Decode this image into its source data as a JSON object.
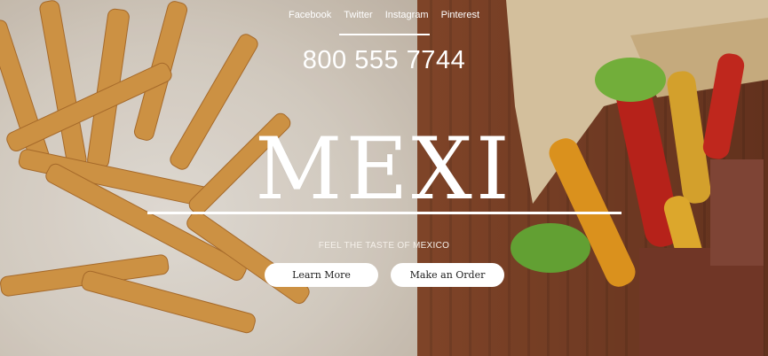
{
  "social": {
    "links": [
      "Facebook",
      "Twitter",
      "Instagram",
      "Pinterest"
    ]
  },
  "contact": {
    "phone": "800 555 7744"
  },
  "brand": {
    "name": "MEXI",
    "tagline": "FEEL THE TASTE OF MEXICO"
  },
  "actions": {
    "learn_more": "Learn More",
    "make_order": "Make an Order"
  },
  "colors": {
    "text": "#ffffff",
    "button_bg": "#ffffff",
    "button_text": "#222222"
  }
}
